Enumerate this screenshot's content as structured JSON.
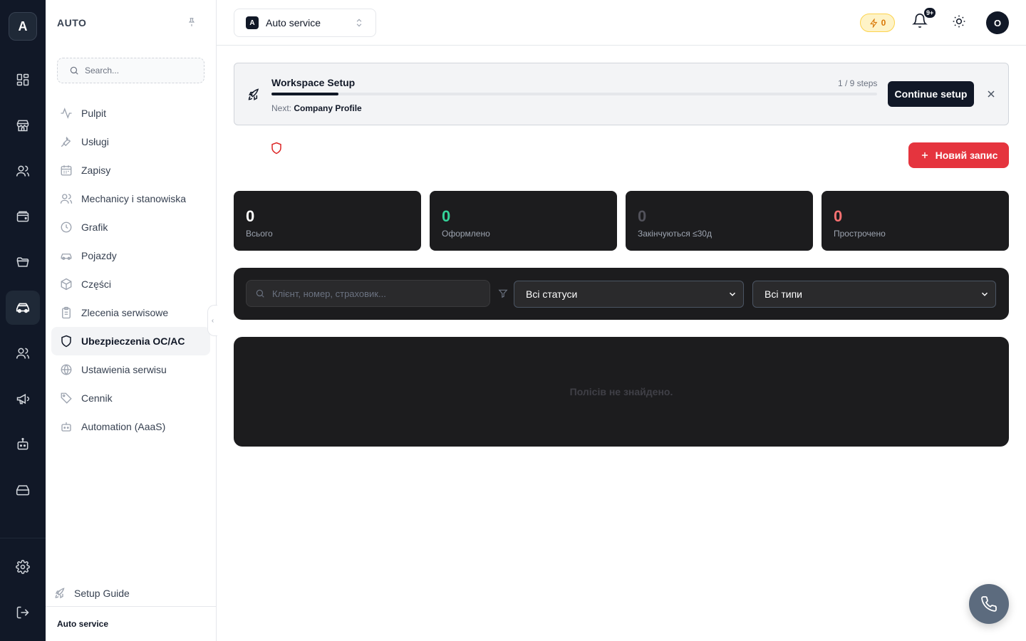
{
  "rail": {
    "logo": "A"
  },
  "sidebar": {
    "title": "AUTO",
    "search_placeholder": "Search...",
    "items": [
      {
        "label": "Pulpit",
        "icon": "activity-icon"
      },
      {
        "label": "Usługi",
        "icon": "wrench-icon"
      },
      {
        "label": "Zapisy",
        "icon": "calendar-icon"
      },
      {
        "label": "Mechanicy i stanowiska",
        "icon": "users-icon"
      },
      {
        "label": "Grafik",
        "icon": "clock-icon"
      },
      {
        "label": "Pojazdy",
        "icon": "car-icon"
      },
      {
        "label": "Części",
        "icon": "box-icon"
      },
      {
        "label": "Zlecenia serwisowe",
        "icon": "clipboard-icon"
      },
      {
        "label": "Ubezpieczenia OC/AC",
        "icon": "shield-icon"
      },
      {
        "label": "Ustawienia serwisu",
        "icon": "globe-icon"
      },
      {
        "label": "Cennik",
        "icon": "tag-icon"
      },
      {
        "label": "Automation (AaaS)",
        "icon": "bot-icon"
      }
    ],
    "setup_guide": "Setup Guide",
    "footer": "Auto service"
  },
  "topbar": {
    "workspace_badge": "A",
    "workspace_name": "Auto service",
    "credits": "0",
    "notifications_badge": "9+",
    "avatar": "O"
  },
  "banner": {
    "title": "Workspace Setup",
    "steps": "1 / 9 steps",
    "progress": 0.111,
    "next_label": "Next:",
    "next_value": "Company Profile",
    "continue_label": "Continue setup"
  },
  "actions": {
    "new_record_label": "Новий запис"
  },
  "stats": [
    {
      "value": "0",
      "label": "Всього",
      "color": "#ffffff"
    },
    {
      "value": "0",
      "label": "Оформлено",
      "color": "#34d399"
    },
    {
      "value": "0",
      "label": "Закінчуються ≤30д",
      "color": "#52525b"
    },
    {
      "value": "0",
      "label": "Прострочено",
      "color": "#f87171"
    }
  ],
  "filters": {
    "search_placeholder": "Клієнт, номер, страховик...",
    "status_value": "Всі статуси",
    "type_value": "Всі типи"
  },
  "empty_state": "Полісів не знайдено.",
  "colors": {
    "accent_red": "#e5343e",
    "dark": "#111827"
  }
}
